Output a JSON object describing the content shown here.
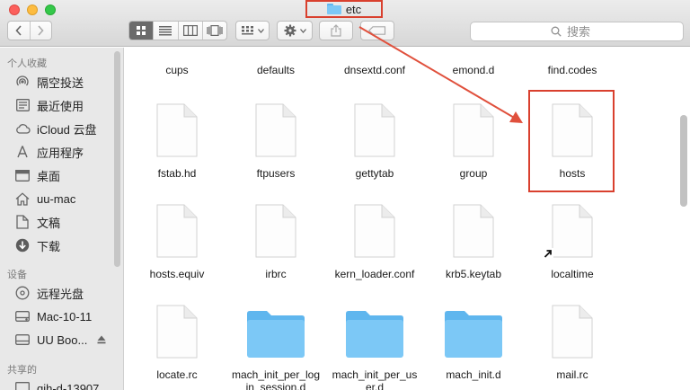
{
  "window": {
    "title": "etc"
  },
  "search": {
    "placeholder": "搜索"
  },
  "icons": {
    "back": "chevron-left-icon",
    "forward": "chevron-right-icon",
    "views": [
      "icon-view-icon",
      "list-view-icon",
      "column-view-icon",
      "cover-flow-icon"
    ],
    "arrange": "arrange-grid-icon",
    "action": "gear-icon",
    "share": "share-icon",
    "tag": "tag-icon",
    "search": "magnifier-icon"
  },
  "colors": {
    "highlight": "#d9402e",
    "folder": "#6ec3f5",
    "active_view": "#6b6b6b"
  },
  "sidebar": {
    "favorites_header": "个人收藏",
    "favorites": [
      {
        "label": "隔空投送",
        "icon": "airdrop-icon"
      },
      {
        "label": "最近使用",
        "icon": "recents-icon"
      },
      {
        "label": "iCloud 云盘",
        "icon": "cloud-icon"
      },
      {
        "label": "应用程序",
        "icon": "applications-icon"
      },
      {
        "label": "桌面",
        "icon": "desktop-icon"
      },
      {
        "label": "uu-mac",
        "icon": "home-icon"
      },
      {
        "label": "文稿",
        "icon": "documents-icon"
      },
      {
        "label": "下载",
        "icon": "downloads-icon"
      }
    ],
    "devices_header": "设备",
    "devices": [
      {
        "label": "远程光盘",
        "icon": "disc-icon"
      },
      {
        "label": "Mac-10-11",
        "icon": "disk-icon"
      },
      {
        "label": "UU Boo...",
        "icon": "external-disk-icon",
        "eject": true
      }
    ],
    "shared_header": "共享的",
    "shared": [
      {
        "label": "qih-d-13907",
        "icon": "computer-icon"
      }
    ]
  },
  "files": [
    {
      "name": "cups",
      "kind": "folder"
    },
    {
      "name": "defaults",
      "kind": "folder"
    },
    {
      "name": "dnsextd.conf",
      "kind": "file"
    },
    {
      "name": "emond.d",
      "kind": "folder"
    },
    {
      "name": "find.codes",
      "kind": "file"
    },
    {
      "name": "fstab.hd",
      "kind": "file"
    },
    {
      "name": "ftpusers",
      "kind": "file"
    },
    {
      "name": "gettytab",
      "kind": "file"
    },
    {
      "name": "group",
      "kind": "file"
    },
    {
      "name": "hosts",
      "kind": "file",
      "highlighted": true
    },
    {
      "name": "hosts.equiv",
      "kind": "file"
    },
    {
      "name": "irbrc",
      "kind": "file"
    },
    {
      "name": "kern_loader.conf",
      "kind": "file"
    },
    {
      "name": "krb5.keytab",
      "kind": "file"
    },
    {
      "name": "localtime",
      "kind": "file",
      "alias": true
    },
    {
      "name": "locate.rc",
      "kind": "file"
    },
    {
      "name": "mach_init_per_log\nin_session.d",
      "kind": "folder"
    },
    {
      "name": "mach_init_per_us\ner.d",
      "kind": "folder"
    },
    {
      "name": "mach_init.d",
      "kind": "folder"
    },
    {
      "name": "mail.rc",
      "kind": "file"
    }
  ]
}
